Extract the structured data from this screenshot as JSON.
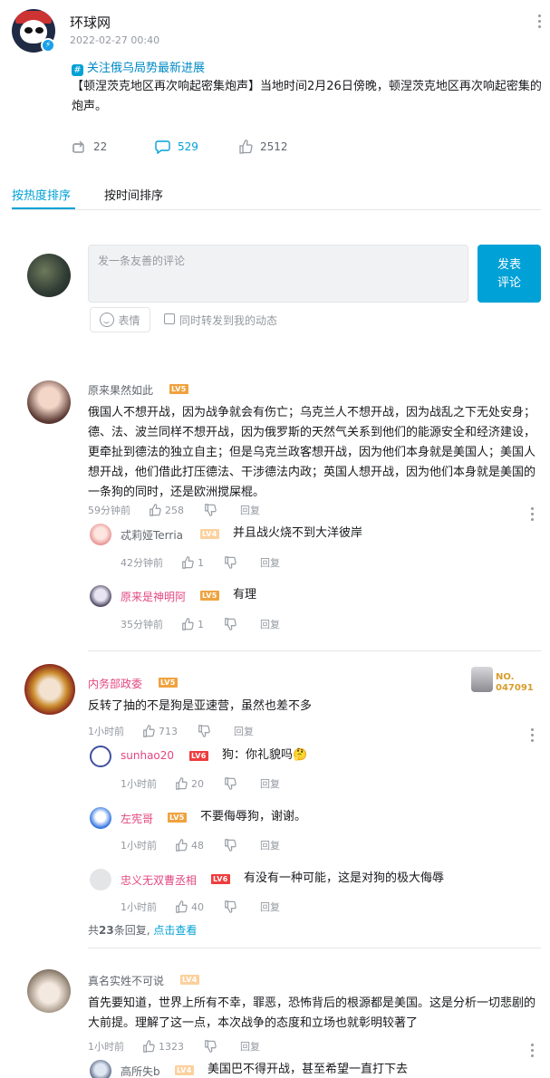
{
  "post": {
    "author": "环球网",
    "time": "2022-02-27 00:40",
    "topic": "关注俄乌局势最新进展",
    "text": "【顿涅茨克地区再次响起密集炮声】当地时间2月26日傍晚，顿涅茨克地区再次响起密集的炮声。",
    "forward_count": "22",
    "comment_count": "529",
    "like_count": "2512"
  },
  "tabs": {
    "hot": "按热度排序",
    "time": "按时间排序"
  },
  "composer": {
    "placeholder": "发一条友善的评论",
    "send_label": "发表评论",
    "emoji_label": "表情",
    "forward_label": "同时转发到我的动态"
  },
  "comments": [
    {
      "user": "原来果然如此",
      "level": "LV5",
      "text": "俄国人不想开战，因为战争就会有伤亡；乌克兰人不想开战，因为战乱之下无处安身；德、法、波兰同样不想开战，因为俄罗斯的天然气关系到他们的能源安全和经济建设，更牵扯到德法的独立自主；但是乌克兰政客想开战，因为他们本身就是美国人；美国人想开战，他们借此打压德法、干涉德法内政；英国人想开战，因为他们本身就是美国的一条狗的同时，还是欧洲搅屎棍。",
      "time": "59分钟前",
      "likes": "258",
      "reply_label": "回复",
      "replies": [
        {
          "user": "忒莉娅Terria",
          "level": "LV4",
          "text": "并且战火烧不到大洋彼岸",
          "time": "42分钟前",
          "likes": "1"
        },
        {
          "user": "原来是神明阿",
          "level": "LV5",
          "text": "有理",
          "time": "35分钟前",
          "likes": "1"
        }
      ]
    },
    {
      "user": "内务部政委",
      "level": "LV5",
      "fan_badge": "NO.\n047091",
      "text": "反转了抽的不是狗是亚速营，虽然也差不多",
      "time": "1小时前",
      "likes": "713",
      "reply_label": "回复",
      "replies": [
        {
          "user": "sunhao20",
          "level": "LV6",
          "text": "狗：你礼貌吗🤔",
          "time": "1小时前",
          "likes": "20"
        },
        {
          "user": "左宪哥",
          "level": "LV5",
          "text": "不要侮辱狗，谢谢。",
          "time": "1小时前",
          "likes": "48"
        },
        {
          "user": "忠义无双曹丞相",
          "level": "LV6",
          "text": "有没有一种可能，这是对狗的极大侮辱",
          "time": "1小时前",
          "likes": "40"
        }
      ],
      "more_prefix": "共",
      "more_count": "23",
      "more_suffix": "条回复,",
      "more_link": "点击查看"
    },
    {
      "user": "真名实姓不可说",
      "level": "LV4",
      "text": "首先要知道，世界上所有不幸，罪恶，恐怖背后的根源都是美国。这是分析一切悲剧的大前提。理解了这一点，本次战争的态度和立场也就彰明较著了",
      "time": "1小时前",
      "likes": "1323",
      "reply_label": "回复",
      "replies": [
        {
          "user": "高所失b",
          "level": "LV4",
          "text": "美国巴不得开战，甚至希望一直打下去"
        }
      ]
    }
  ],
  "colors": {
    "accent": "#00a1d6",
    "vip_name": "#e3467f",
    "muted": "#9499a0"
  }
}
